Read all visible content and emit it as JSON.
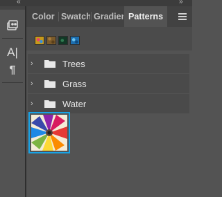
{
  "top_strip": {
    "collapse_left": "‹‹",
    "collapse_right": "››"
  },
  "tabs": [
    {
      "label": "Color",
      "active": false
    },
    {
      "label": "Swatches",
      "active": false
    },
    {
      "label": "Gradients",
      "active": false
    },
    {
      "label": "Patterns",
      "active": true
    }
  ],
  "panel_menu_icon": "hamburger-menu-icon",
  "left_tools": [
    {
      "name": "libraries-tool-icon"
    },
    {
      "name": "character-tool-icon",
      "glyph": "A|"
    },
    {
      "name": "paragraph-tool-icon",
      "glyph": "¶"
    }
  ],
  "recent_patterns": [
    {
      "name": "pattern-preset-1",
      "color": "#c79a1a"
    },
    {
      "name": "pattern-preset-2",
      "color": "#7a5a2a"
    },
    {
      "name": "pattern-preset-3",
      "color": "#123826"
    },
    {
      "name": "pattern-preset-4",
      "color": "#1d6fb0"
    }
  ],
  "groups": [
    {
      "label": "Trees"
    },
    {
      "label": "Grass"
    },
    {
      "label": "Water"
    }
  ],
  "selected_pattern": {
    "name": "colored-pencils-pattern"
  },
  "colors": {
    "accent": "#18a3e6",
    "panel_bg": "#535353",
    "tab_bar_bg": "#424242"
  }
}
